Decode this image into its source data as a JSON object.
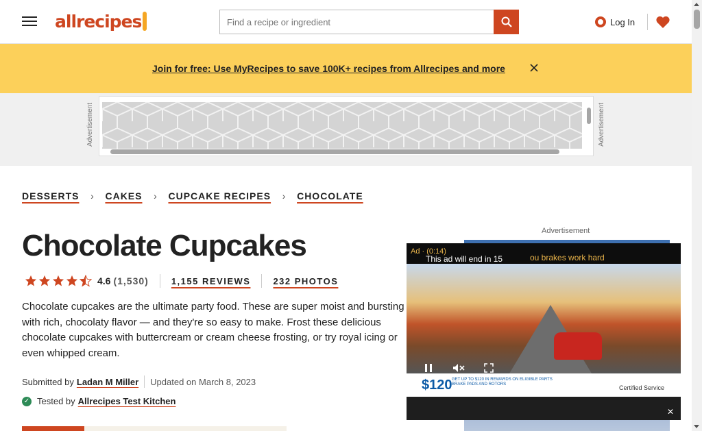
{
  "colors": {
    "brand": "#ce4620",
    "banner": "#fcd05a",
    "accent_gold": "#f5a623",
    "tested_check": "#2e8b57"
  },
  "header": {
    "logo_text": "allrecipes",
    "search": {
      "placeholder": "Find a recipe or ingredient",
      "value": ""
    },
    "search_button_icon": "search-icon",
    "login_label": "Log In",
    "menu_icon": "hamburger-icon",
    "saved_icon": "heart-icon"
  },
  "banner": {
    "link_text": "Join for free: Use MyRecipes to save 100K+ recipes from Allrecipes and more"
  },
  "top_ad": {
    "label": "Advertisement"
  },
  "breadcrumb": [
    {
      "label": "DESSERTS"
    },
    {
      "label": "CAKES"
    },
    {
      "label": "CUPCAKE RECIPES"
    },
    {
      "label": "CHOCOLATE"
    }
  ],
  "recipe": {
    "title": "Chocolate Cupcakes",
    "rating": {
      "value": "4.6",
      "stars": 4.5,
      "count": "(1,530)"
    },
    "reviews_label": "1,155 REVIEWS",
    "photos_label": "232 PHOTOS",
    "description": "Chocolate cupcakes are the ultimate party food. These are super moist and bursting with rich, chocolaty flavor — and they're so easy to make. Frost these delicious chocolate cupcakes with buttercream or cream cheese frosting, or try royal icing or even whipped cream.",
    "submitted_prefix": "Submitted by",
    "author": "Ladan M Miller",
    "updated": "Updated on March 8, 2023",
    "tested_prefix": "Tested by",
    "tester": "Allrecipes Test Kitchen"
  },
  "right_ad": {
    "label": "Advertisement"
  },
  "video_ad": {
    "time_label": "Ad · (0:14)",
    "end_text": "This ad will end in 15",
    "headline": "ou brakes work hard",
    "promo_price": "$120",
    "promo_text": "GET UP TO $120 IN REWARDS ON ELIGIBLE PARTS BRAKE PADS AND ROTORS",
    "promo_brand": "Certified Service",
    "controls": [
      "pause-icon",
      "mute-icon",
      "fullscreen-icon"
    ]
  }
}
